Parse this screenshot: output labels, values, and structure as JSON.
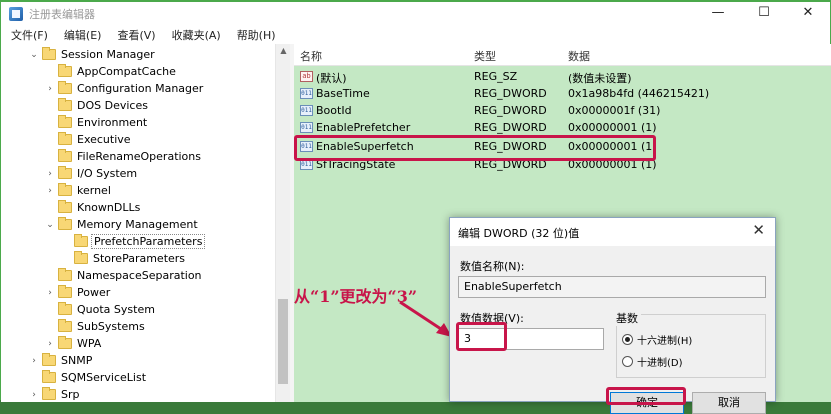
{
  "window": {
    "title": "注册表编辑器",
    "minimize": "—",
    "maximize": "☐",
    "close": "✕"
  },
  "menu": [
    "文件(F)",
    "编辑(E)",
    "查看(V)",
    "收藏夹(A)",
    "帮助(H)"
  ],
  "tree": [
    {
      "label": "Session Manager",
      "arrow": "⌄"
    },
    {
      "label": "AppCompatCache",
      "arrow": ""
    },
    {
      "label": "Configuration Manager",
      "arrow": "›"
    },
    {
      "label": "DOS Devices",
      "arrow": ""
    },
    {
      "label": "Environment",
      "arrow": ""
    },
    {
      "label": "Executive",
      "arrow": ""
    },
    {
      "label": "FileRenameOperations",
      "arrow": ""
    },
    {
      "label": "I/O System",
      "arrow": "›"
    },
    {
      "label": "kernel",
      "arrow": "›"
    },
    {
      "label": "KnownDLLs",
      "arrow": ""
    },
    {
      "label": "Memory Management",
      "arrow": "⌄"
    },
    {
      "label": "PrefetchParameters",
      "arrow": ""
    },
    {
      "label": "StoreParameters",
      "arrow": ""
    },
    {
      "label": "NamespaceSeparation",
      "arrow": ""
    },
    {
      "label": "Power",
      "arrow": "›"
    },
    {
      "label": "Quota System",
      "arrow": ""
    },
    {
      "label": "SubSystems",
      "arrow": ""
    },
    {
      "label": "WPA",
      "arrow": "›"
    },
    {
      "label": "SNMP",
      "arrow": "›"
    },
    {
      "label": "SQMServiceList",
      "arrow": ""
    },
    {
      "label": "Srp",
      "arrow": "›"
    }
  ],
  "list": {
    "headers": {
      "name": "名称",
      "type": "类型",
      "data": "数据"
    },
    "rows": [
      {
        "icon": "ab",
        "name": "(默认)",
        "type": "REG_SZ",
        "data": "(数值未设置)"
      },
      {
        "icon": "011",
        "name": "BaseTime",
        "type": "REG_DWORD",
        "data": "0x1a98b4fd (446215421)"
      },
      {
        "icon": "011",
        "name": "BootId",
        "type": "REG_DWORD",
        "data": "0x0000001f (31)"
      },
      {
        "icon": "011",
        "name": "EnablePrefetcher",
        "type": "REG_DWORD",
        "data": "0x00000001 (1)"
      },
      {
        "icon": "011",
        "name": "EnableSuperfetch",
        "type": "REG_DWORD",
        "data": "0x00000001 (1)"
      },
      {
        "icon": "011",
        "name": "SfTracingState",
        "type": "REG_DWORD",
        "data": "0x00000001 (1)"
      }
    ]
  },
  "dialog": {
    "title": "编辑 DWORD (32 位)值",
    "close": "✕",
    "name_label": "数值名称(N):",
    "name_value": "EnableSuperfetch",
    "data_label": "数值数据(V):",
    "data_value": "3",
    "base_label": "基数",
    "radio_hex": "十六进制(H)",
    "radio_dec": "十进制(D)",
    "base_selected": "hex",
    "ok": "确定",
    "cancel": "取消"
  },
  "annotation": "从“1”更改为“3”",
  "colors": {
    "highlight": "#c8154a",
    "list_bg": "#c4e8c4",
    "border": "#4ba94b"
  }
}
